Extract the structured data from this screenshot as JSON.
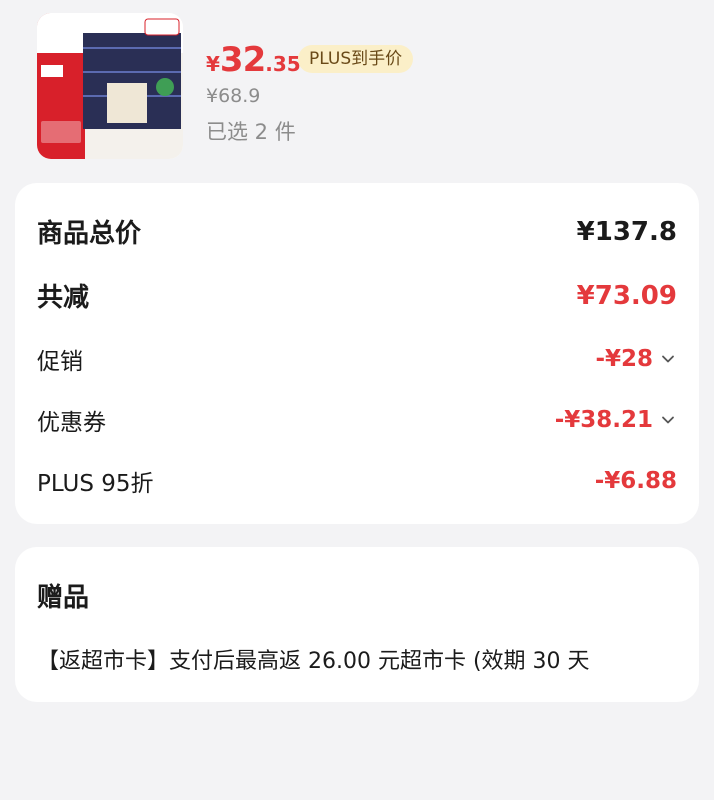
{
  "product": {
    "image_alt": "tissue pack product image",
    "price_currency": "¥",
    "price_integer": "32",
    "price_decimal": ".35",
    "plus_tag": "PLUS到手价",
    "original_price": "¥68.9",
    "selected_count": "已选 2 件"
  },
  "summary": {
    "total_label": "商品总价",
    "total_value": "¥137.8",
    "discount_label": "共减",
    "discount_value": "¥73.09",
    "promo_label": "促销",
    "promo_value": "-¥28",
    "coupon_label": "优惠券",
    "coupon_value": "-¥38.21",
    "plus_label": "PLUS 95折",
    "plus_value": "-¥6.88"
  },
  "gift": {
    "title": "赠品",
    "text": "【返超市卡】支付后最高返 26.00 元超市卡 (效期 30 天"
  },
  "colors": {
    "accent_red": "#e4393c",
    "plus_tag_bg": "#fbefc8"
  }
}
